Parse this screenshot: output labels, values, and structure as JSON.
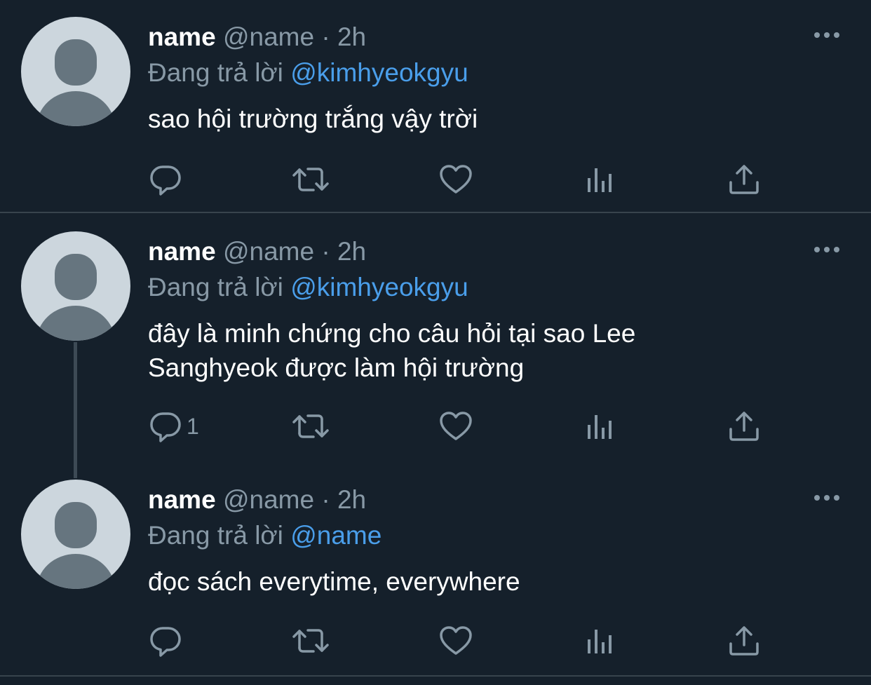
{
  "tweets": [
    {
      "name": "name",
      "handle": "@name",
      "separator": "·",
      "time": "2h",
      "reply_prefix": "Đang trả lời",
      "reply_to": "@kimhyeokgyu",
      "text": "sao hội trường trắng vậy trời",
      "reply_count": ""
    },
    {
      "name": "name",
      "handle": "@name",
      "separator": "·",
      "time": "2h",
      "reply_prefix": "Đang trả lời",
      "reply_to": "@kimhyeokgyu",
      "text": "đây là minh chứng cho câu hỏi tại sao Lee Sanghyeok được làm hội trường",
      "reply_count": "1"
    },
    {
      "name": "name",
      "handle": "@name",
      "separator": "·",
      "time": "2h",
      "reply_prefix": "Đang trả lời",
      "reply_to": "@name",
      "text": "đọc sách everytime, everywhere",
      "reply_count": ""
    }
  ],
  "icons": {
    "reply": "reply-icon",
    "retweet": "retweet-icon",
    "like": "heart-icon",
    "views": "views-icon",
    "share": "share-icon",
    "more": "more-icon"
  },
  "colors": {
    "background": "#15202b",
    "secondary_text": "#8899a6",
    "mention": "#4a9eea",
    "divider": "#38444d"
  }
}
